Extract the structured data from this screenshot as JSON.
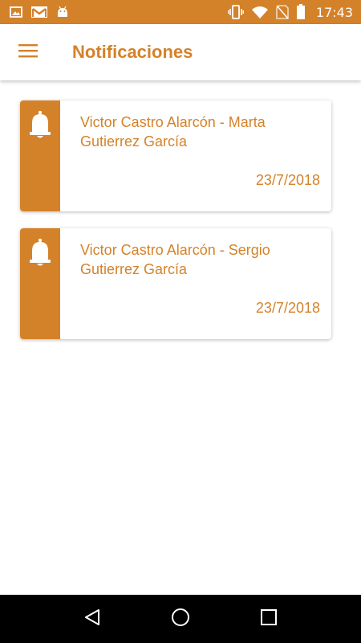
{
  "status_bar": {
    "time": "17:43",
    "icons": [
      "image-icon",
      "gmail-icon",
      "android-icon",
      "vibrate-icon",
      "wifi-icon",
      "no-sim-icon",
      "battery-icon"
    ]
  },
  "app_bar": {
    "title": "Notificaciones",
    "menu_icon": "hamburger-menu-icon"
  },
  "notifications": [
    {
      "title": "Victor Castro Alarcón - Marta Gutierrez García",
      "date": "23/7/2018",
      "icon": "bell-icon"
    },
    {
      "title": "Victor Castro Alarcón - Sergio Gutierrez García",
      "date": "23/7/2018",
      "icon": "bell-icon"
    }
  ],
  "nav_bar": {
    "buttons": [
      "back-icon",
      "home-icon",
      "recents-icon"
    ]
  },
  "colors": {
    "accent": "#d4822a",
    "background": "#ffffff",
    "nav_bar": "#000000"
  }
}
